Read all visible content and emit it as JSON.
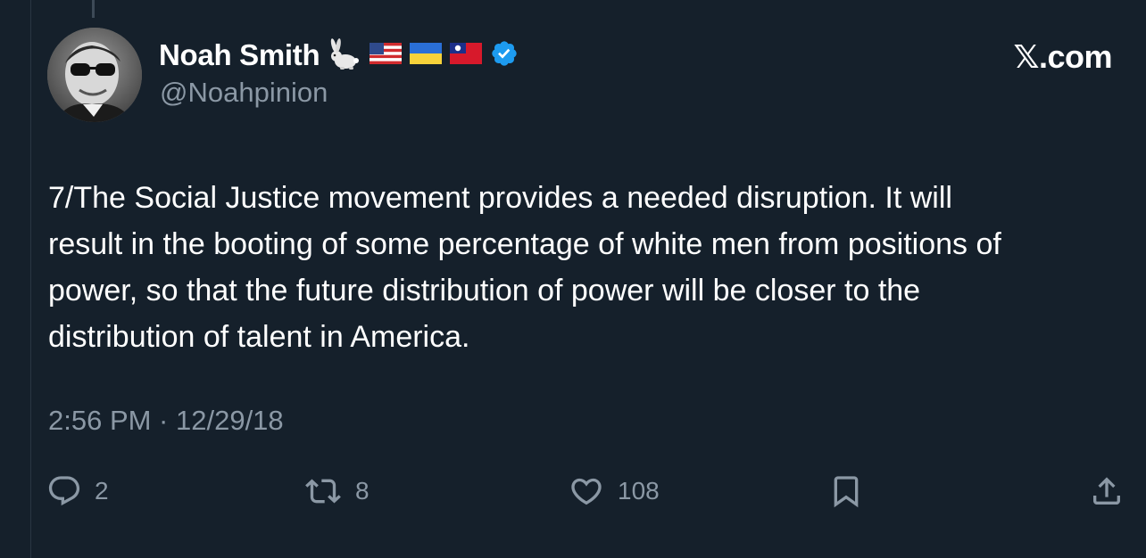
{
  "header": {
    "display_name": "Noah Smith",
    "handle": "@Noahpinion",
    "brand": "𝕏.com",
    "name_icons": [
      "rabbit-icon",
      "us-flag-icon",
      "ukraine-flag-icon",
      "taiwan-flag-icon",
      "verified-badge-icon"
    ]
  },
  "tweet": {
    "text": "7/The Social Justice movement provides a needed disruption. It will\nresult in the booting of some percentage of white men from positions of\npower, so that the future distribution of power will be closer to the\ndistribution of talent in America.",
    "timestamp": "2:56 PM · 12/29/18"
  },
  "actions": {
    "replies": "2",
    "reposts": "8",
    "likes": "108"
  },
  "colors": {
    "background": "#15202b",
    "text": "#ffffff",
    "secondary": "#8b98a5",
    "verified": "#1d9bf0"
  }
}
